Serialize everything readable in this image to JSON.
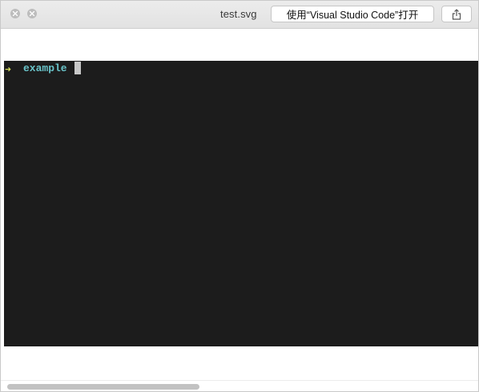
{
  "window": {
    "file_name": "test.svg",
    "open_with_label": "使用“Visual Studio Code”打开"
  },
  "icons": {
    "close": "close-icon",
    "minimize": "minimize-icon",
    "share": "share-icon",
    "prompt": "arrow-right-icon"
  },
  "terminal": {
    "prompt_symbol": "➜",
    "text": "example"
  },
  "colors": {
    "terminal_bg": "#1c1c1c",
    "prompt_arrow": "#d4dc5a",
    "prompt_text": "#69c3c9",
    "cursor": "#c8c8c8"
  }
}
